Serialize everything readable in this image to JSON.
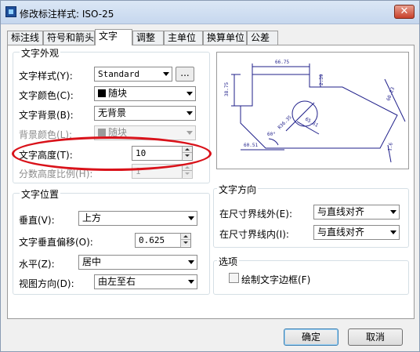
{
  "window": {
    "title": "修改标注样式: ISO-25",
    "close_glyph": "✕"
  },
  "tabs": [
    "标注线",
    "符号和箭头",
    "文字",
    "调整",
    "主单位",
    "换算单位",
    "公差"
  ],
  "text_appearance": {
    "group_label": "文字外观",
    "style_label": "文字样式(Y):",
    "style_value": "Standard",
    "ellipsis": "...",
    "color_label": "文字颜色(C):",
    "color_value": "随块",
    "background_label": "文字背景(B):",
    "background_value": "无背景",
    "bg_color_label": "背景颜色(L):",
    "bg_color_value": "随块",
    "height_label": "文字高度(T):",
    "height_value": "10",
    "fraction_label": "分数高度比例(H):",
    "fraction_value": "1"
  },
  "text_position": {
    "group_label": "文字位置",
    "vertical_label": "垂直(V):",
    "vertical_value": "上方",
    "offset_label": "文字垂直偏移(O):",
    "offset_value": "0.625",
    "horizontal_label": "水平(Z):",
    "horizontal_value": "居中",
    "view_label": "视图方向(D):",
    "view_value": "由左至右"
  },
  "text_direction": {
    "group_label": "文字方向",
    "outside_label": "在尺寸界线外(E):",
    "outside_value": "与直线对齐",
    "inside_label": "在尺寸界线内(I):",
    "inside_value": "与直线对齐"
  },
  "options": {
    "group_label": "选项",
    "frame_label": "绘制文字边框(F)"
  },
  "preview": {
    "dims": [
      "66.75",
      "38.75",
      "2.39",
      "60.23",
      "R36.35",
      "65.61",
      "60.51",
      "1.6",
      "60°"
    ]
  },
  "buttons": {
    "ok": "确定",
    "cancel": "取消"
  },
  "colors": {
    "highlight_ring": "#d9121a",
    "preview_line": "#1f1f8a"
  }
}
